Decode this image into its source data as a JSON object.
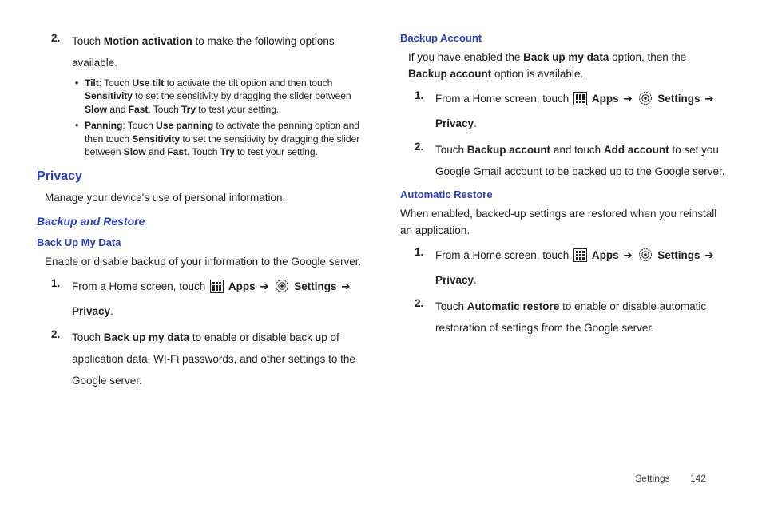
{
  "left": {
    "step2": {
      "num": "2.",
      "pre": "Touch ",
      "bold1": "Motion activation",
      "post": " to make the following options available."
    },
    "bullet_tilt": {
      "label": "Tilt",
      "sep": ": Touch ",
      "b1": "Use tilt",
      "t1": " to activate the tilt option and then touch ",
      "b2": "Sensitivity",
      "t2": " to set the sensitivity by dragging the slider between ",
      "b3": "Slow",
      "t3": " and ",
      "b4": "Fast",
      "t4": ". Touch ",
      "b5": "Try",
      "t5": " to test your setting."
    },
    "bullet_pan": {
      "label": "Panning",
      "sep": ": Touch ",
      "b1": "Use panning",
      "t1": " to activate the panning option and then touch ",
      "b2": "Sensitivity",
      "t2": " to set the sensitivity by dragging the slider between ",
      "b3": "Slow",
      "t3": " and ",
      "b4": "Fast",
      "t4": ". Touch ",
      "b5": "Try",
      "t5": " to test your setting."
    },
    "privacy_h": "Privacy",
    "privacy_p": "Manage your device's use of personal information.",
    "backup_restore_h": "Backup and Restore",
    "backup_mydata_h": "Back Up My Data",
    "backup_mydata_p": "Enable or disable backup of your information to the Google server.",
    "bm_step1": {
      "num": "1.",
      "t1": "From a Home screen, touch ",
      "apps": "Apps",
      "arr": "➔",
      "settings": "Settings",
      "arr2": "➔",
      "privacy": "Privacy",
      "dot": "."
    },
    "bm_step2": {
      "num": "2.",
      "t1": "Touch ",
      "b1": "Back up my data",
      "t2": " to enable or disable back up of application data, WI-Fi passwords, and other settings to the Google server."
    }
  },
  "right": {
    "backup_account_h": "Backup Account",
    "ba_p": {
      "t1": "If you have enabled the ",
      "b1": "Back up my data",
      "t2": " option, then the ",
      "b2": "Backup account",
      "t3": " option is available."
    },
    "ba_step1": {
      "num": "1.",
      "t1": "From a Home screen, touch ",
      "apps": "Apps",
      "arr": "➔",
      "settings": "Settings",
      "arr2": "➔",
      "privacy": "Privacy",
      "dot": "."
    },
    "ba_step2": {
      "num": "2.",
      "t1": "Touch ",
      "b1": "Backup account",
      "t2": " and touch ",
      "b2": "Add account",
      "t3": " to set you Google Gmail account to be backed up to the Google server."
    },
    "auto_restore_h": "Automatic Restore",
    "ar_p": "When enabled, backed-up settings are restored when you reinstall an application.",
    "ar_step1": {
      "num": "1.",
      "t1": "From a Home screen, touch ",
      "apps": "Apps",
      "arr": "➔",
      "settings": "Settings",
      "arr2": "➔",
      "privacy": "Privacy",
      "dot": "."
    },
    "ar_step2": {
      "num": "2.",
      "t1": "Touch ",
      "b1": "Automatic restore",
      "t2": " to enable or disable automatic restoration of settings from the Google server."
    }
  },
  "footer": {
    "section": "Settings",
    "page": "142"
  }
}
